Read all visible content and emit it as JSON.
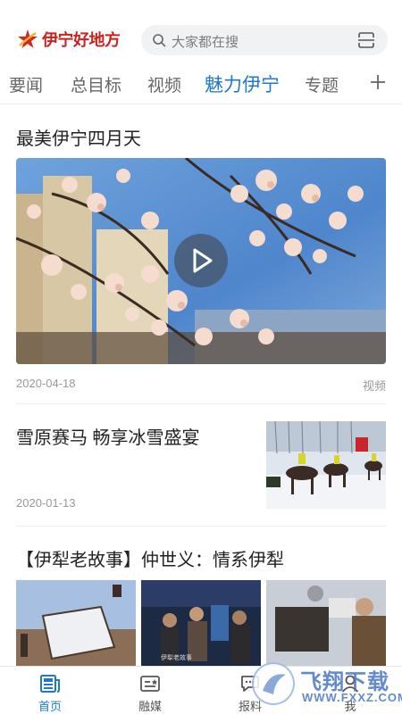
{
  "header": {
    "logo_text": "伊宁好地方",
    "search_placeholder": "大家都在搜"
  },
  "tabs": [
    {
      "label": "要闻",
      "active": false
    },
    {
      "label": "总目标",
      "active": false
    },
    {
      "label": "视频",
      "active": false
    },
    {
      "label": "魅力伊宁",
      "active": true
    },
    {
      "label": "专题",
      "active": false
    }
  ],
  "articles": [
    {
      "title": "最美伊宁四月天",
      "date": "2020-04-18",
      "tag": "视频",
      "media": "video"
    },
    {
      "title": "雪原赛马 畅享冰雪盛宴",
      "date": "2020-01-13",
      "media": "thumbnail"
    },
    {
      "title": "【伊犁老故事】仲世义：情系伊犁",
      "media": "gallery",
      "image_caption": "伊犁老故事"
    }
  ],
  "bottom_nav": [
    {
      "label": "首页",
      "icon": "news-home-icon",
      "active": true
    },
    {
      "label": "融媒",
      "icon": "media-card-icon",
      "active": false
    },
    {
      "label": "报料",
      "icon": "report-chat-icon",
      "active": false
    },
    {
      "label": "我",
      "icon": "user-icon",
      "active": false
    }
  ],
  "watermark": {
    "text": "飞翔下载",
    "url": "WWW.FXXZ.COM"
  },
  "colors": {
    "accent": "#1f78c8",
    "brand": "#c8221e",
    "meta": "#999999"
  }
}
